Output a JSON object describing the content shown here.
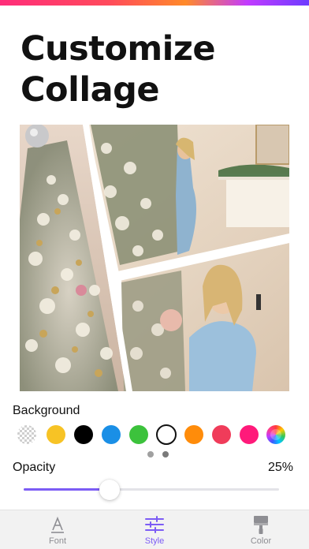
{
  "header": {
    "title_line1": "Customize",
    "title_line2": "Collage",
    "accent_gradient": [
      "#ff2d7a",
      "#ff8a2a",
      "#c23bff",
      "#6d3bff"
    ]
  },
  "background": {
    "label": "Background",
    "swatches": [
      {
        "name": "transparent",
        "color": "transparent"
      },
      {
        "name": "yellow",
        "color": "#f7c325"
      },
      {
        "name": "black",
        "color": "#000000"
      },
      {
        "name": "blue",
        "color": "#1a8fe6"
      },
      {
        "name": "green",
        "color": "#3cc23c"
      },
      {
        "name": "white",
        "color": "#ffffff",
        "selected": true
      },
      {
        "name": "orange",
        "color": "#ff8c0a"
      },
      {
        "name": "red",
        "color": "#f03c5a"
      },
      {
        "name": "pink",
        "color": "#ff1a7a"
      },
      {
        "name": "rainbow",
        "color": "multicolor"
      }
    ],
    "page_count": 2,
    "current_page": 1
  },
  "opacity": {
    "label": "Opacity",
    "value_text": "25%",
    "value": 0.25,
    "accent_color": "#7c5cf5"
  },
  "tabs": [
    {
      "label": "Font",
      "icon": "font-icon",
      "active": false
    },
    {
      "label": "Style",
      "icon": "sliders-icon",
      "active": true
    },
    {
      "label": "Color",
      "icon": "paint-roller-icon",
      "active": false
    }
  ]
}
